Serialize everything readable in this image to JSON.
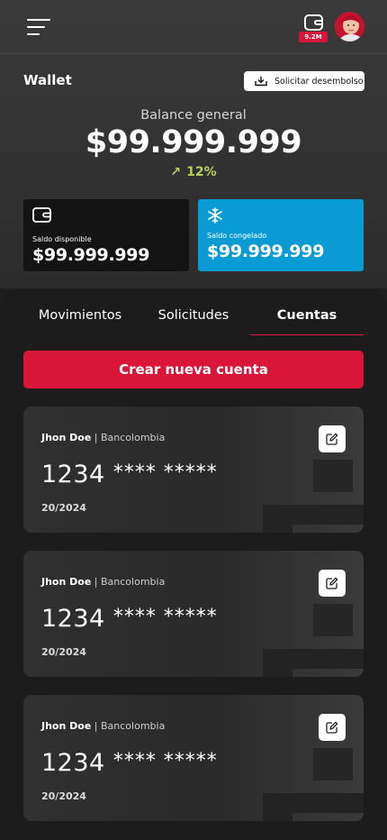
{
  "header": {
    "wallet_badge": "9.2M",
    "menu_icon": "hamburger-menu-icon",
    "wallet_icon": "wallet-icon"
  },
  "wallet": {
    "title": "Wallet",
    "disburse_label": "Solicitar desembolso",
    "balance_label": "Balance general",
    "balance_value": "$99.999.999",
    "growth_value": "12%",
    "growth_color": "#b6d25a"
  },
  "balances": {
    "available": {
      "label": "Saldo disponible",
      "amount": "$99.999.999",
      "icon": "wallet-icon"
    },
    "frozen": {
      "label": "Saldo congelado",
      "amount": "$99.999.999",
      "icon": "snowflake-icon",
      "color": "#0a9bd4"
    }
  },
  "tabs": [
    {
      "label": "Movimientos",
      "active": false
    },
    {
      "label": "Solicitudes",
      "active": false
    },
    {
      "label": "Cuentas",
      "active": true
    }
  ],
  "create_account_label": "Crear nueva cuenta",
  "accent_color": "#d9153a",
  "accounts": [
    {
      "holder": "Jhon Doe",
      "bank": "Bancolombia",
      "number_visible": "1234",
      "number_masked": "**** *****",
      "date": "20/2024"
    },
    {
      "holder": "Jhon Doe",
      "bank": "Bancolombia",
      "number_visible": "1234",
      "number_masked": "**** *****",
      "date": "20/2024"
    },
    {
      "holder": "Jhon Doe",
      "bank": "Bancolombia",
      "number_visible": "1234",
      "number_masked": "**** *****",
      "date": "20/2024"
    }
  ]
}
